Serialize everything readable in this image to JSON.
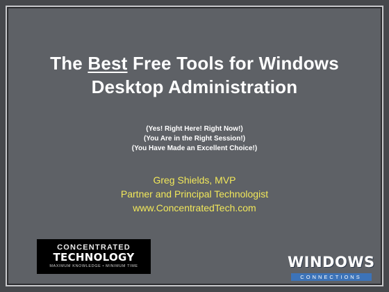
{
  "slide": {
    "title_pre": "The ",
    "title_emph": "Best",
    "title_line1_rest": " Free Tools for Windows",
    "title_line2": "Desktop Administration",
    "subtitles": [
      "(Yes!  Right Here! Right Now!)",
      "(You Are in the Right Session!)",
      "(You Have Made an Excellent Choice!)"
    ],
    "presenter": {
      "name": "Greg Shields, MVP",
      "role": "Partner and Principal Technologist",
      "website": "www.ConcentratedTech.com"
    },
    "logos": {
      "concentrated_technology": {
        "line1": "CONCENTRATED",
        "line2": "TECHNOLOGY",
        "tagline": "MAXIMUM KNOWLEDGE • MINIMUM TIME"
      },
      "windows_connections": {
        "line1": "WINDOWS",
        "line2": "CONNECTIONS"
      }
    },
    "colors": {
      "background": "#5e6166",
      "title": "#ffffff",
      "presenter_text": "#f2e85a",
      "connections_band": "#3c73b8"
    }
  }
}
